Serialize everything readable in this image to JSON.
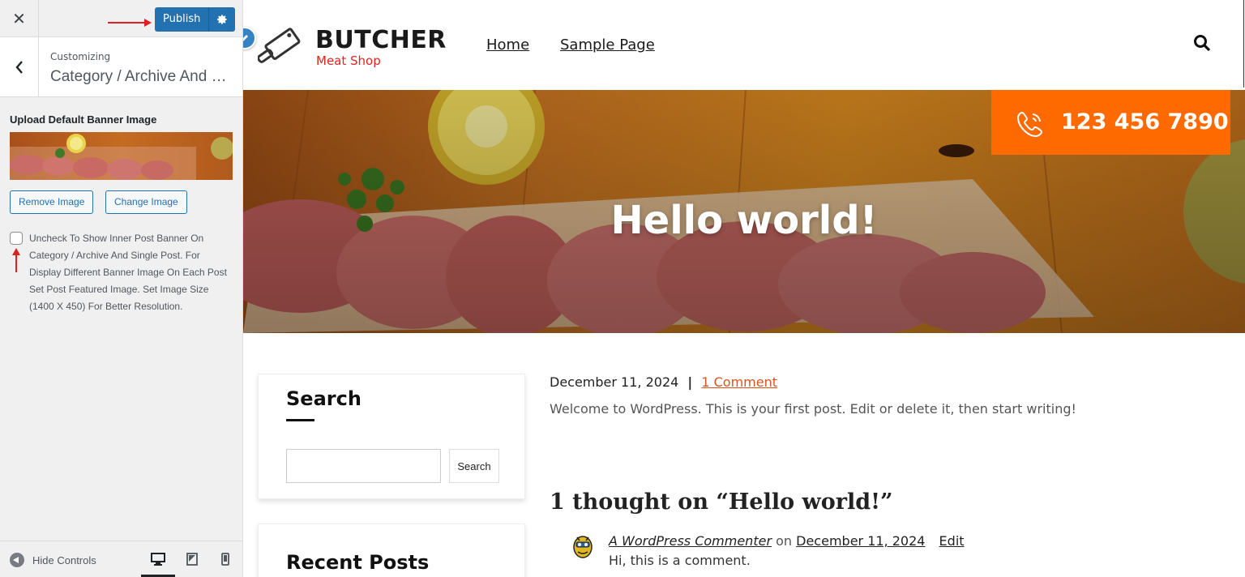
{
  "customizer": {
    "close_icon": "close-icon",
    "publish_label": "Publish",
    "publish_settings_icon": "gear-icon",
    "back_icon": "chevron-left-icon",
    "customizing_label": "Customizing",
    "section_title": "Category / Archive And Single Post",
    "control_title": "Upload Default Banner Image",
    "remove_image_label": "Remove Image",
    "change_image_label": "Change Image",
    "checkbox_checked": false,
    "checkbox_text": "Uncheck To Show Inner Post Banner On Category / Archive And Single Post. For Display Different Banner Image On Each Post Set Post Featured Image. Set Image Size (1400 X 450) For Better Resolution.",
    "hide_controls_label": "Hide Controls",
    "devices": [
      "desktop-icon",
      "tablet-icon",
      "mobile-icon"
    ],
    "active_device": "desktop"
  },
  "site": {
    "brand": "BUTCHER",
    "brand_sub": "Meat Shop",
    "nav": [
      "Home",
      "Sample Page"
    ],
    "search_icon": "search-icon",
    "phone": "123 456 7890",
    "accent": "#ff6a00",
    "brand_red": "#e0261f"
  },
  "hero": {
    "title": "Hello world!"
  },
  "sidebar_widgets": {
    "search_title": "Search",
    "search_placeholder": "",
    "search_button": "Search",
    "recent_posts_title": "Recent Posts"
  },
  "post": {
    "date": "December 11, 2024",
    "separator": "|",
    "comments_link": "1 Comment",
    "excerpt": "Welcome to WordPress. This is your first post. Edit or delete it, then start writing!",
    "thoughts_heading": "1 thought on “Hello world!”"
  },
  "comment": {
    "author": "A WordPress Commenter",
    "on": "on",
    "date": "December 11, 2024",
    "edit": "Edit",
    "text": "Hi, this is a comment."
  }
}
